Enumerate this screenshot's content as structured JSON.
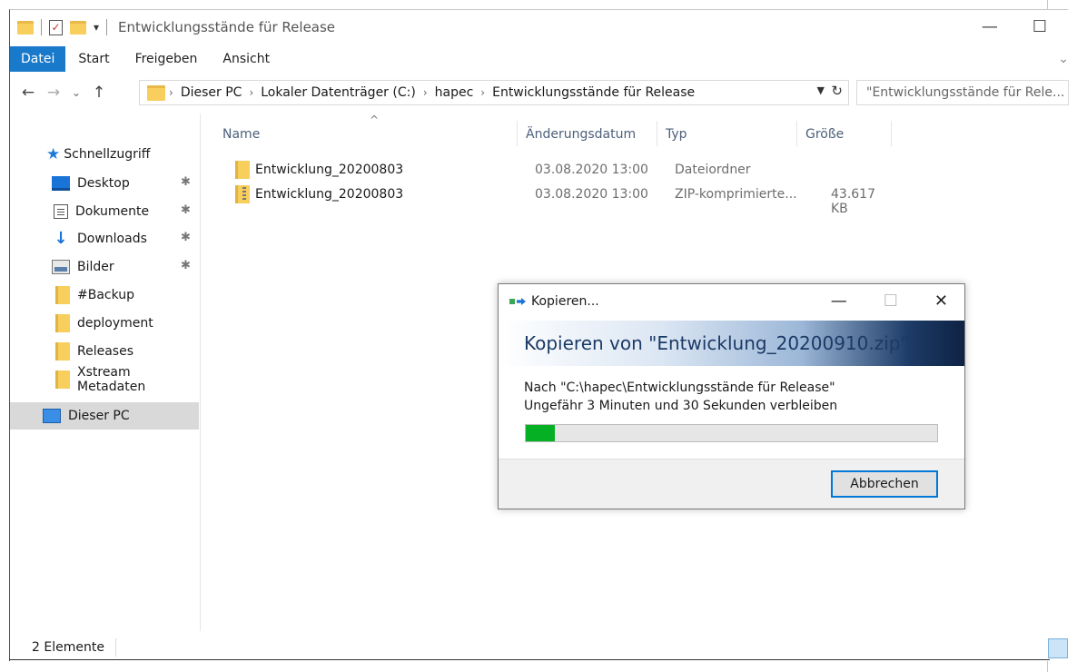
{
  "window": {
    "title": "Entwicklungsstände für Release",
    "minimize_glyph": "—",
    "maximize_glyph": "☐"
  },
  "ribbon": {
    "tabs": [
      {
        "label": "Datei",
        "active": true
      },
      {
        "label": "Start",
        "active": false
      },
      {
        "label": "Freigeben",
        "active": false
      },
      {
        "label": "Ansicht",
        "active": false
      }
    ]
  },
  "address": {
    "breadcrumbs": [
      "Dieser PC",
      "Lokaler Datenträger (C:)",
      "hapec",
      "Entwicklungsstände für Release"
    ],
    "search_placeholder": "\"Entwicklungsstände für Rele..."
  },
  "navpane": {
    "quick_access_label": "Schnellzugriff",
    "items": [
      {
        "label": "Desktop",
        "icon": "desktop-icon",
        "pinned": true
      },
      {
        "label": "Dokumente",
        "icon": "documents-icon",
        "pinned": true
      },
      {
        "label": "Downloads",
        "icon": "downloads-icon",
        "pinned": true
      },
      {
        "label": "Bilder",
        "icon": "pictures-icon",
        "pinned": true
      },
      {
        "label": "#Backup",
        "icon": "folder-icon",
        "pinned": false
      },
      {
        "label": "deployment",
        "icon": "folder-icon",
        "pinned": false
      },
      {
        "label": "Releases",
        "icon": "folder-icon",
        "pinned": false
      },
      {
        "label": "Xstream Metadaten",
        "icon": "folder-icon",
        "pinned": false
      }
    ],
    "this_pc_label": "Dieser PC"
  },
  "filelist": {
    "columns": [
      "Name",
      "Änderungsdatum",
      "Typ",
      "Größe"
    ],
    "rows": [
      {
        "name": "Entwicklung_20200803",
        "date": "03.08.2020 13:00",
        "type": "Dateiordner",
        "size": "",
        "icon": "folder-icon"
      },
      {
        "name": "Entwicklung_20200803",
        "date": "03.08.2020 13:00",
        "type": "ZIP-komprimierte...",
        "size": "43.617 KB",
        "icon": "zip-folder-icon"
      }
    ]
  },
  "status": {
    "item_count": "2 Elemente"
  },
  "dialog": {
    "title": "Kopieren...",
    "heading": "Kopieren von \"Entwicklung_20200910.zip\"",
    "destination": "Nach \"C:\\hapec\\Entwicklungsstände für Release\"",
    "remaining": "Ungefähr 3 Minuten und 30 Sekunden verbleiben",
    "progress_fraction": 0.07,
    "cancel_label": "Abbrechen",
    "close_glyph": "✕",
    "colors": {
      "progress": "#06b025",
      "header_dark": "#0e2244",
      "focus_border": "#0078d7"
    }
  }
}
